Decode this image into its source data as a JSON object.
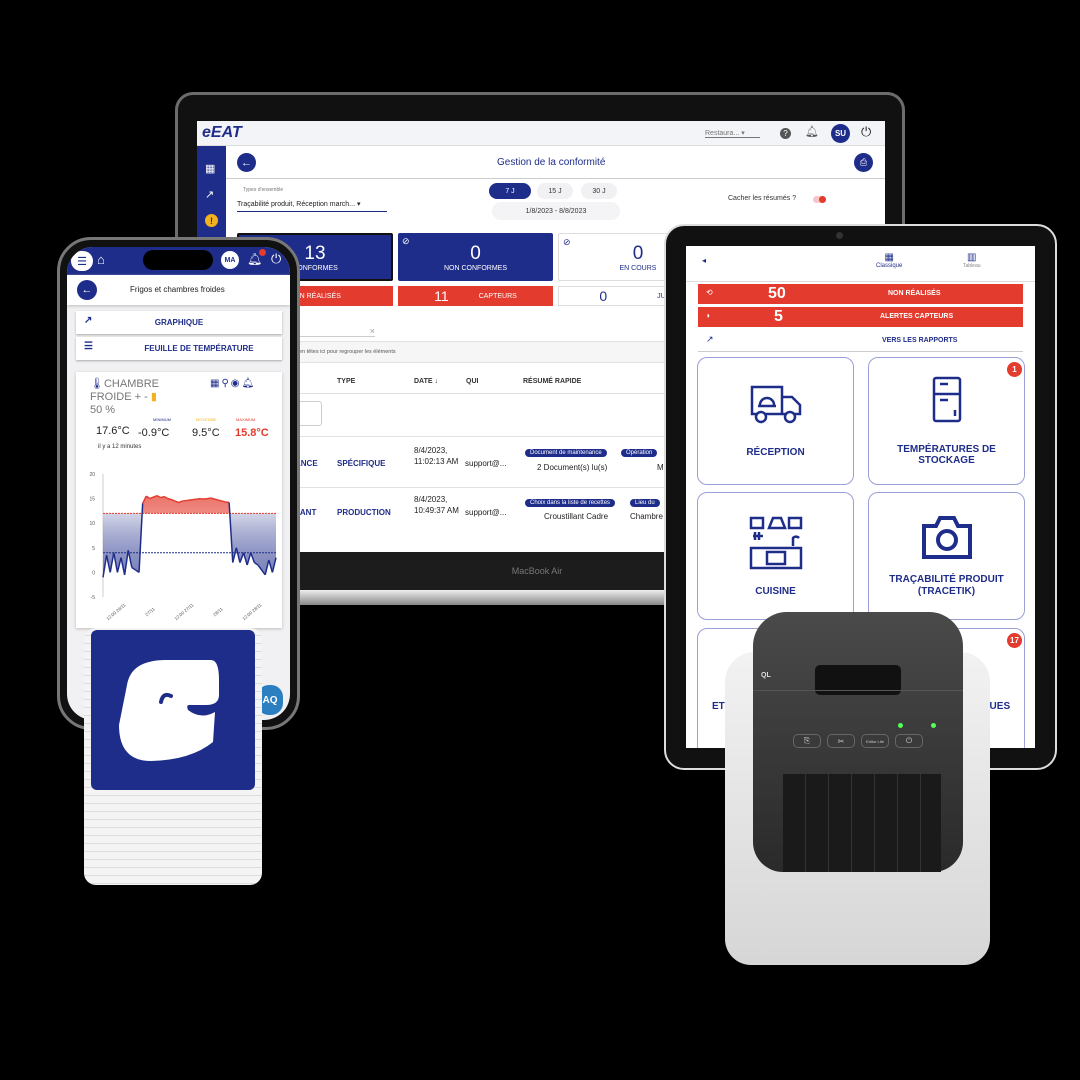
{
  "laptop": {
    "logo": "eEAT",
    "device_label": "MacBook Air",
    "header": {
      "restaurant_select": "Restaura...",
      "avatar": "SU"
    },
    "page_title": "Gestion de la conformité",
    "filters": {
      "types_label": "Types d'ensemble",
      "types_value": "Traçabilité produit, Réception march...",
      "periods": [
        "7 J",
        "15 J",
        "30 J"
      ],
      "active_period": "7 J",
      "date_range": "1/8/2023 - 8/8/2023",
      "hide_summaries_label": "Cacher les résumés ?"
    },
    "stats": [
      {
        "value": "13",
        "label": "CONFORMES"
      },
      {
        "value": "0",
        "label": "NON CONFORMES"
      },
      {
        "value": "0",
        "label": "EN COURS"
      }
    ],
    "alerts": [
      {
        "value": "",
        "label": "NON RÉALISÉS"
      },
      {
        "value": "11",
        "label": "CAPTEURS"
      },
      {
        "value": "0",
        "label": "JUSTI"
      }
    ],
    "group_hint": "en têtes ici pour regrouper les éléments",
    "columns": [
      "TYPE",
      "DATE",
      "QUI",
      "RÉSUMÉ RAPIDE"
    ],
    "rows": [
      {
        "name": "ANCE",
        "type": "SPÉCIFIQUE",
        "date": "8/4/2023, 11:02:13 AM",
        "who": "support@...",
        "chip1": "Document de maintenance",
        "value1": "2 Document(s) lu(s)",
        "chip2": "Opération",
        "value2": "M"
      },
      {
        "name": "LANT",
        "type": "PRODUCTION",
        "date": "8/4/2023, 10:49:37 AM",
        "who": "support@...",
        "chip1": "Choix dans la liste de recettes",
        "value1": "Croustillant Cadre",
        "chip2": "Lieu du",
        "value2": "Chambre f"
      },
      {
        "name": "E"
      }
    ]
  },
  "phone": {
    "avatar": "MA",
    "title": "Frigos et chambres froides",
    "buttons": [
      "GRAPHIQUE",
      "FEUILLE DE TEMPÉRATURE"
    ],
    "sensor": {
      "name": "CHAMBRE FROIDE + -",
      "battery": "50 %",
      "current": "17.6°C",
      "min_label": "MINIMUM",
      "min": "-0.9°C",
      "avg_label": "MOYENNE",
      "avg": "9.5°C",
      "max_label": "MAXIMUM",
      "max": "15.8°C",
      "updated": "il y a 12 minutes"
    },
    "faq": "AQ"
  },
  "chart_data": {
    "type": "area",
    "title": "",
    "xlabel": "",
    "ylabel": "",
    "ylim": [
      -5,
      20
    ],
    "yticks": [
      20,
      15,
      10,
      5,
      0,
      -5
    ],
    "xticks": [
      "12:00 26/11",
      "27/11",
      "12:00 27/11",
      "28/11",
      "12:00 28/11"
    ],
    "thresholds": {
      "upper": 12,
      "lower": 4
    },
    "values": [
      -1,
      3.5,
      0,
      4,
      0,
      3,
      -0.5,
      4.5,
      1,
      0.5,
      0,
      14,
      15.5,
      15,
      15.3,
      15.6,
      15.2,
      15.4,
      15,
      14.8,
      14.5,
      14.2,
      14.5,
      14.6,
      14.7,
      14.8,
      14.9,
      15,
      14.9,
      15,
      15.1,
      14.9,
      14.7,
      14.5,
      14.3,
      14.2,
      2,
      5,
      2,
      4,
      1.5,
      4,
      2,
      1.5,
      0.5,
      -0.5,
      2.5,
      0,
      3
    ],
    "colors": {
      "above": "#e33b2e",
      "below": "#1f2d8a"
    }
  },
  "tablet": {
    "views": [
      "Classique",
      "Tableau"
    ],
    "bars": [
      {
        "value": "50",
        "label": "NON RÉALISÉS"
      },
      {
        "value": "5",
        "label": "ALERTES CAPTEURS"
      }
    ],
    "reports": "VERS LES RAPPORTS",
    "tiles": [
      {
        "label": "RÉCEPTION",
        "badge": ""
      },
      {
        "label": "TEMPÉRATURES DE STOCKAGE",
        "badge": "1"
      },
      {
        "label": "CUISINE",
        "badge": ""
      },
      {
        "label": "TRAÇABILITÉ PRODUIT (TRACETIK)",
        "badge": ""
      },
      {
        "label": "ETIQ",
        "badge": ""
      },
      {
        "label": "IQUES",
        "badge": "17"
      }
    ]
  },
  "printer": {
    "brand": "QL",
    "buttons": [
      "feed",
      "cut",
      "Editor Lite",
      "power"
    ]
  },
  "colors": {
    "brand": "#1f2d8a",
    "alert": "#e33b2e",
    "background": "#000000"
  }
}
